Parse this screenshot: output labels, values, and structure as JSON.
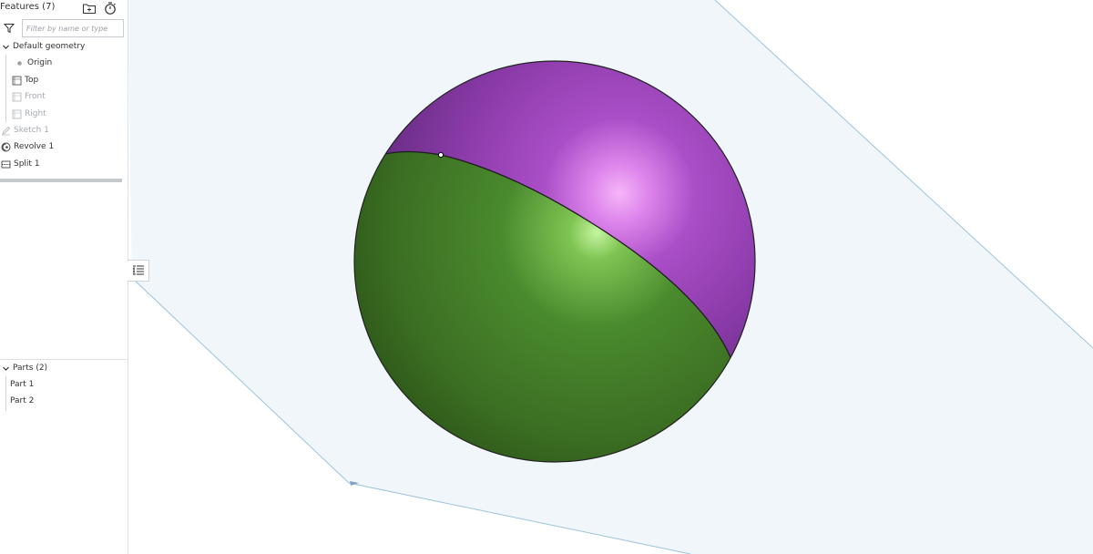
{
  "features": {
    "title": "Features (7)",
    "filter_placeholder": "Filter by name or type",
    "default_geometry": "Default geometry",
    "items": [
      {
        "label": "Origin",
        "icon": "origin-icon",
        "state": "active"
      },
      {
        "label": "Top",
        "icon": "plane-icon",
        "state": "active"
      },
      {
        "label": "Front",
        "icon": "plane-icon",
        "state": "hidden"
      },
      {
        "label": "Right",
        "icon": "plane-icon",
        "state": "hidden"
      },
      {
        "label": "Sketch 1",
        "icon": "sketch-icon",
        "state": "hidden"
      },
      {
        "label": "Revolve 1",
        "icon": "revolve-icon",
        "state": "active"
      },
      {
        "label": "Split 1",
        "icon": "split-icon",
        "state": "active"
      }
    ]
  },
  "parts": {
    "title": "Parts (2)",
    "items": [
      {
        "label": "Part 1"
      },
      {
        "label": "Part 2"
      }
    ]
  },
  "colors": {
    "top_part": "#9b45b8",
    "bottom_part": "#4a7f2a",
    "plane_fill": "#f0f6f9",
    "plane_edge": "#9cc3dc",
    "disabled_text": "#a5aab0"
  }
}
